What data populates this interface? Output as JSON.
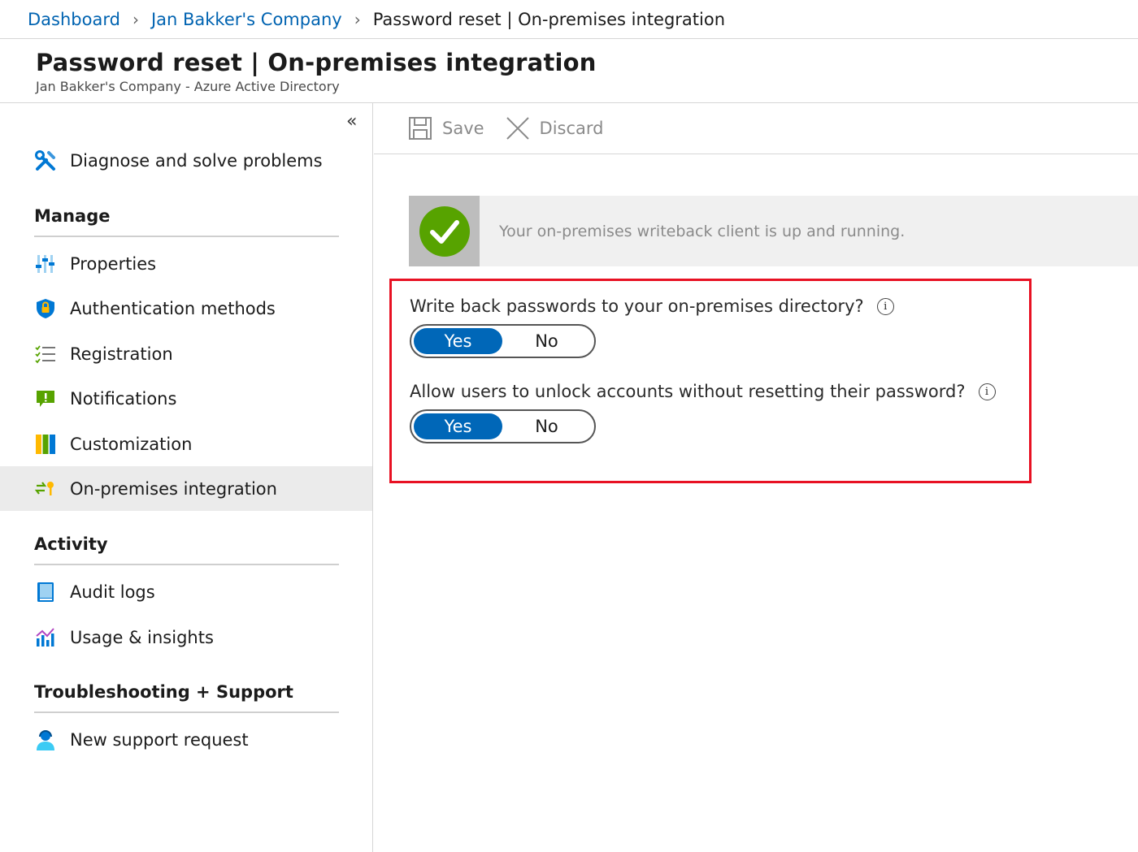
{
  "breadcrumb": {
    "items": [
      "Dashboard",
      "Jan Bakker's Company"
    ],
    "current": "Password reset | On-premises integration"
  },
  "header": {
    "title": "Password reset | On-premises integration",
    "subtitle": "Jan Bakker's Company - Azure Active Directory"
  },
  "sidebar": {
    "collapse_glyph": "«",
    "diagnose": "Diagnose and solve problems",
    "sections": {
      "manage": "Manage",
      "activity": "Activity",
      "support": "Troubleshooting + Support"
    },
    "items": {
      "properties": "Properties",
      "auth_methods": "Authentication methods",
      "registration": "Registration",
      "notifications": "Notifications",
      "customization": "Customization",
      "onprem": "On-premises integration",
      "audit_logs": "Audit logs",
      "usage": "Usage & insights",
      "new_support": "New support request"
    }
  },
  "toolbar": {
    "save_label": "Save",
    "discard_label": "Discard"
  },
  "banner": {
    "text": "Your on-premises writeback client is up and running."
  },
  "settings": {
    "writeback": {
      "question": "Write back passwords to your on-premises directory?",
      "yes": "Yes",
      "no": "No",
      "selected": "Yes"
    },
    "unlock": {
      "question": "Allow users to unlock accounts without resetting their password?",
      "yes": "Yes",
      "no": "No",
      "selected": "Yes"
    },
    "info_glyph": "i"
  },
  "colors": {
    "link": "#0063b1",
    "toggle_on": "#0067b8",
    "highlight": "#e81123",
    "success": "#57a300"
  }
}
